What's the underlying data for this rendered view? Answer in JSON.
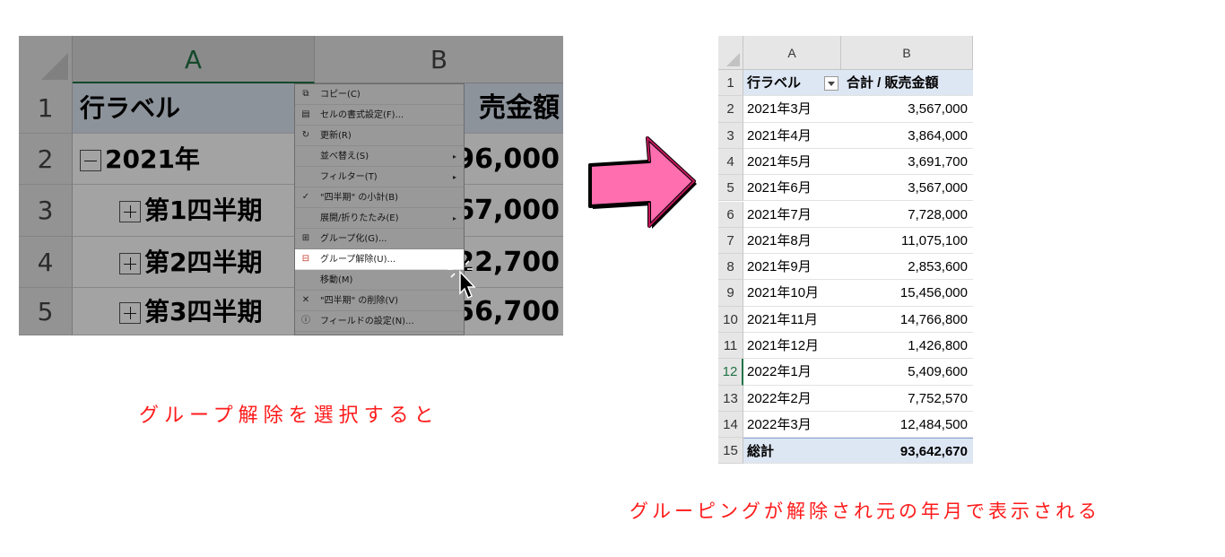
{
  "left_panel": {
    "col_headers": [
      "A",
      "B"
    ],
    "rows": [
      {
        "num": "1",
        "a": "行ラベル",
        "b": "売金額",
        "expander": ""
      },
      {
        "num": "2",
        "a": "2021年",
        "b": "96,000",
        "expander": "minus"
      },
      {
        "num": "3",
        "a": "第1四半期",
        "b": "67,000",
        "expander": "plus"
      },
      {
        "num": "4",
        "a": "第2四半期",
        "b": "22,700",
        "expander": "plus"
      },
      {
        "num": "5",
        "a": "第3四半期",
        "b": "56,700",
        "expander": "plus"
      }
    ],
    "context_menu": [
      {
        "label": "コピー(C)",
        "icon": "copy-icon",
        "submenu": false
      },
      {
        "label": "セルの書式設定(F)...",
        "icon": "format-cells-icon",
        "submenu": false
      },
      {
        "label": "更新(R)",
        "icon": "refresh-icon",
        "submenu": false
      },
      {
        "label": "並べ替え(S)",
        "icon": "",
        "submenu": true
      },
      {
        "label": "フィルター(T)",
        "icon": "",
        "submenu": true
      },
      {
        "label": "\"四半期\" の小計(B)",
        "icon": "check-icon",
        "submenu": false
      },
      {
        "label": "展開/折りたたみ(E)",
        "icon": "",
        "submenu": true
      },
      {
        "label": "グループ化(G)...",
        "icon": "group-icon",
        "submenu": false
      },
      {
        "label": "グループ解除(U)...",
        "icon": "ungroup-icon",
        "submenu": false,
        "highlighted": true
      },
      {
        "label": "移動(M)",
        "icon": "",
        "submenu": false
      },
      {
        "label": "\"四半期\" の削除(V)",
        "icon": "delete-x-icon",
        "submenu": false
      },
      {
        "label": "フィールドの設定(N)...",
        "icon": "field-settings-icon",
        "submenu": false
      }
    ]
  },
  "right_panel": {
    "col_headers": [
      "A",
      "B"
    ],
    "header_row": {
      "num": "1",
      "a": "行ラベル",
      "b": "合計 / 販売金額"
    },
    "rows": [
      {
        "num": "2",
        "a": "2021年3月",
        "b": "3,567,000"
      },
      {
        "num": "3",
        "a": "2021年4月",
        "b": "3,864,000"
      },
      {
        "num": "4",
        "a": "2021年5月",
        "b": "3,691,700"
      },
      {
        "num": "5",
        "a": "2021年6月",
        "b": "3,567,000"
      },
      {
        "num": "6",
        "a": "2021年7月",
        "b": "7,728,000"
      },
      {
        "num": "7",
        "a": "2021年8月",
        "b": "11,075,100"
      },
      {
        "num": "8",
        "a": "2021年9月",
        "b": "2,853,600"
      },
      {
        "num": "9",
        "a": "2021年10月",
        "b": "15,456,000"
      },
      {
        "num": "10",
        "a": "2021年11月",
        "b": "14,766,800"
      },
      {
        "num": "11",
        "a": "2021年12月",
        "b": "1,426,800"
      },
      {
        "num": "12",
        "a": "2022年1月",
        "b": "5,409,600",
        "selected": true
      },
      {
        "num": "13",
        "a": "2022年2月",
        "b": "7,752,570"
      },
      {
        "num": "14",
        "a": "2022年3月",
        "b": "12,484,500"
      }
    ],
    "total_row": {
      "num": "15",
      "a": "総計",
      "b": "93,642,670"
    }
  },
  "captions": {
    "left": "グループ解除を選択すると",
    "right": "グルーピングが解除され元の年月で表示される"
  },
  "colors": {
    "caption": "#ff1a1a",
    "arrow_fill": "#ff6fb0",
    "pivot_header_band": "#dde6f3",
    "excel_green": "#217346"
  }
}
